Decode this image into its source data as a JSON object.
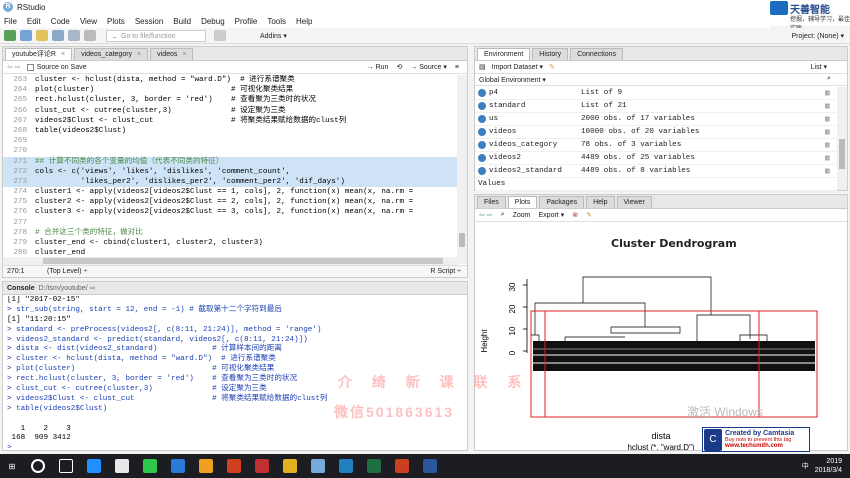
{
  "window": {
    "title": "RStudio"
  },
  "branding": {
    "name": "天善智能",
    "tagline": "挖掘，辅导学习，最佳实践"
  },
  "menu": [
    "File",
    "Edit",
    "Code",
    "View",
    "Plots",
    "Session",
    "Build",
    "Debug",
    "Profile",
    "Tools",
    "Help"
  ],
  "toolbar": {
    "goto_placeholder": "Go to file/function",
    "addins": "Addins ▾",
    "project": "Project: (None) ▾"
  },
  "editor": {
    "tabs": [
      "youtube评论R",
      "videos_category",
      "videos"
    ],
    "source_on_save": "Source on Save",
    "run": "→ Run",
    "source": "→ Source ▾",
    "lines": [
      {
        "n": "263",
        "t": "cluster <- hclust(dista, method = \"ward.D\")  # 进行系谱聚类"
      },
      {
        "n": "264",
        "t": "plot(cluster)                              # 可视化聚类结果"
      },
      {
        "n": "265",
        "t": "rect.hclust(cluster, 3, border = 'red')    # 查看聚为三类时的状况"
      },
      {
        "n": "266",
        "t": "clust_cut <- cutree(cluster,3)             # 设定聚为三类"
      },
      {
        "n": "267",
        "t": "videos2$Clust <- clust_cut                 # 将聚类结果赋给数据的clust列"
      },
      {
        "n": "268",
        "t": "table(videos2$Clust)"
      },
      {
        "n": "269",
        "t": ""
      },
      {
        "n": "270",
        "t": ""
      },
      {
        "n": "271",
        "t": "## 计算不同类的各个变量的均值（代表不同类的特征）"
      },
      {
        "n": "272",
        "t": "cols <- c('views', 'likes', 'dislikes', 'comment_count',"
      },
      {
        "n": "273",
        "t": "          'likes_per2', 'dislikes_per2', 'comment_per2', 'dif_days')"
      },
      {
        "n": "274",
        "t": "cluster1 <- apply(videos2[videos2$Clust == 1, cols], 2, function(x) mean(x, na.rm ="
      },
      {
        "n": "275",
        "t": "cluster2 <- apply(videos2[videos2$Clust == 2, cols], 2, function(x) mean(x, na.rm ="
      },
      {
        "n": "276",
        "t": "cluster3 <- apply(videos2[videos2$Clust == 3, cols], 2, function(x) mean(x, na.rm ="
      },
      {
        "n": "277",
        "t": ""
      },
      {
        "n": "278",
        "t": "# 合并这三个类的特征，做对比"
      },
      {
        "n": "279",
        "t": "cluster_end <- cbind(cluster1, cluster2, cluster3)"
      },
      {
        "n": "280",
        "t": "cluster_end"
      },
      {
        "n": "281",
        "t": ""
      }
    ],
    "status_pos": "270:1",
    "status_ctx": "(Top Level) ÷",
    "status_lang": "R Script ÷"
  },
  "console": {
    "title": "Console",
    "path": "D:/tsm/youtube/ ⇨",
    "lines": [
      {
        "k": "out",
        "t": "[1] \"2017-02-15\""
      },
      {
        "k": "in",
        "t": "> str_sub(string, start = 12, end = -1) # 截取第十二个字符到最后"
      },
      {
        "k": "out",
        "t": "[1] \"11:20:15\""
      },
      {
        "k": "in",
        "t": "> standard <- preProcess(videos2[, c(8:11, 21:24)], method = 'range')"
      },
      {
        "k": "in",
        "t": "> videos2_standard <- predict(standard, videos2[, c(8:11, 21:24)])"
      },
      {
        "k": "in",
        "t": "> dista <- dist(videos2_standard)            # 计算样本间的距离"
      },
      {
        "k": "in",
        "t": "> cluster <- hclust(dista, method = \"ward.D\")  # 进行系谱聚类"
      },
      {
        "k": "in",
        "t": "> plot(cluster)                              # 可视化聚类结果"
      },
      {
        "k": "in",
        "t": "> rect.hclust(cluster, 3, border = 'red')    # 查看聚为三类时的状况"
      },
      {
        "k": "in",
        "t": "> clust_cut <- cutree(cluster,3)             # 设定聚为三类"
      },
      {
        "k": "in",
        "t": "> videos2$Clust <- clust_cut                 # 将聚类结果赋给数据的clust列"
      },
      {
        "k": "in",
        "t": "> table(videos2$Clust)"
      },
      {
        "k": "out",
        "t": ""
      },
      {
        "k": "out",
        "t": "   1    2    3"
      },
      {
        "k": "out",
        "t": " 168  909 3412"
      },
      {
        "k": "in",
        "t": ">"
      }
    ]
  },
  "environment": {
    "tabs": [
      "Environment",
      "History",
      "Connections"
    ],
    "import": "Import Dataset ▾",
    "list": "List ▾",
    "global": "Global Environment ▾",
    "rows": [
      {
        "name": "p4",
        "value": "List of 9"
      },
      {
        "name": "standard",
        "value": "List of 21"
      },
      {
        "name": "us",
        "value": "2000 obs. of 17 variables"
      },
      {
        "name": "videos",
        "value": "10000 obs. of 20 variables"
      },
      {
        "name": "videos_category",
        "value": "78 obs. of 3 variables"
      },
      {
        "name": "videos2",
        "value": "4489 obs. of 25 variables"
      },
      {
        "name": "videos2_standard",
        "value": "4489 obs. of 8 variables"
      },
      {
        "name": "Values",
        "value": ""
      }
    ]
  },
  "plots": {
    "tabs": [
      "Files",
      "Plots",
      "Packages",
      "Help",
      "Viewer"
    ],
    "zoom": "Zoom",
    "export": "Export ▾",
    "title": "Cluster Dendrogram",
    "ylabel": "Height",
    "yticks": [
      "30",
      "20",
      "10",
      "0"
    ],
    "xlabel1": "dista",
    "xlabel2": "hclust (*, \"ward.D\")",
    "win_watermark": "激活 Windows"
  },
  "overlay": {
    "text1": "介 绮 新 课 联 系",
    "text2": "微信501863613"
  },
  "camtasia": {
    "line1": "Created by Camtasia",
    "line2": "Buy now to prevent this tag",
    "line3": "www.techsmith.com"
  },
  "taskbar": {
    "ime": "中",
    "time": "2019",
    "date": "2018/3/4"
  }
}
